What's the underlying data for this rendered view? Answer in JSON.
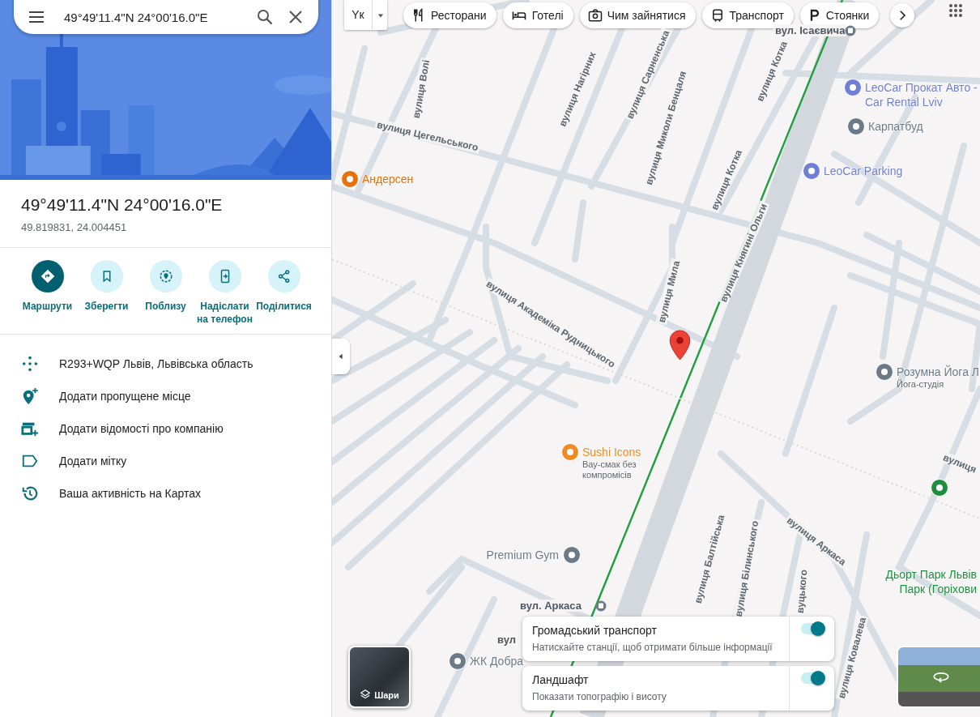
{
  "search": {
    "value": "49°49'11.4\"N 24°00'16.0\"E"
  },
  "place": {
    "title": "49°49'11.4\"N 24°00'16.0\"E",
    "coords": "49.819831, 24.004451"
  },
  "actions": [
    {
      "label": "Маршрути",
      "filled": true
    },
    {
      "label": "Зберегти",
      "filled": false
    },
    {
      "label": "Поблизу",
      "filled": false
    },
    {
      "label": "Надіслати на телефон",
      "filled": false
    },
    {
      "label": "Поділитися",
      "filled": false
    }
  ],
  "details": [
    {
      "label": "R293+WQP Львів, Львівська область"
    },
    {
      "label": "Додати пропущене місце"
    },
    {
      "label": "Додати відомості про компанію"
    },
    {
      "label": "Додати мітку"
    },
    {
      "label": "Ваша активність на Картах"
    }
  ],
  "map": {
    "input_tool": "Yк",
    "chips": [
      {
        "label": "Ресторани"
      },
      {
        "label": "Готелі"
      },
      {
        "label": "Чим зайнятися"
      },
      {
        "label": "Транспорт"
      },
      {
        "label": "Стоянки"
      }
    ],
    "streets": [
      {
        "name": "вулиця Волі"
      },
      {
        "name": "вулиця Нагірних"
      },
      {
        "name": "вулиця Сарненська"
      },
      {
        "name": "вулиця Миколи Бенцаля"
      },
      {
        "name": "вулиця Котка"
      },
      {
        "name": "вулиця Котка"
      },
      {
        "name": "вулиця Цегельського"
      },
      {
        "name": "вулиця Княгині Ольги"
      },
      {
        "name": "вулиця Мила"
      },
      {
        "name": "вулиця Академіка Рудницького"
      },
      {
        "name": "вулиця Балтійська"
      },
      {
        "name": "вулиця Білинського"
      },
      {
        "name": "вуцького"
      },
      {
        "name": "вулиця Аркаса"
      },
      {
        "name": "вулиця Ковалева"
      },
      {
        "name": "вулиця"
      }
    ],
    "stops": [
      {
        "name": "вул. Ісаєвича"
      },
      {
        "name": "вул. Аркаса"
      },
      {
        "name": "вул"
      }
    ],
    "pois": [
      {
        "name": "Андерсен",
        "color": "#e8710a"
      },
      {
        "name": "LeoCar Прокат Авто - Car Rental Lviv",
        "color": "#6f7fd6"
      },
      {
        "name": "Карпатбуд",
        "color": "#6b7a86"
      },
      {
        "name": "LeoCar Parking",
        "color": "#6f7fd6"
      },
      {
        "name": "Розумна Йога Л",
        "subtitle": "Йога-студія",
        "color": "#6b7a86"
      },
      {
        "name": "Sushi Icons",
        "subtitle": "Вау-смак без компромісів",
        "color": "#f08a24"
      },
      {
        "name": "Premium Gym",
        "color": "#6b7a86"
      },
      {
        "name": "ЖК Добра",
        "color": "#6b7a86"
      },
      {
        "name": "Дьорт Парк Львів Парк (Горіхови",
        "color": "#1e8e3e"
      }
    ],
    "layers_button": {
      "label": "Шари"
    },
    "layers": [
      {
        "title": "Громадський транспорт",
        "subtitle": "Натискайте станції, щоб отримати більше інформації",
        "on": true
      },
      {
        "title": "Ландшафт",
        "subtitle": "Показати топографію і висоту",
        "on": true
      }
    ]
  }
}
